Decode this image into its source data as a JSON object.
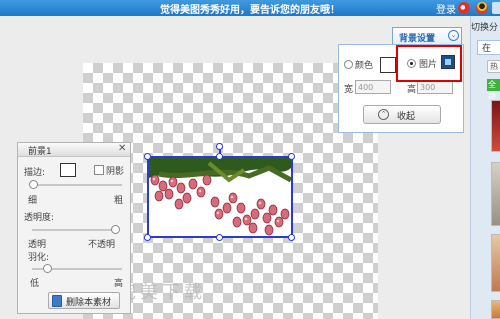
{
  "topbar": {
    "title": "觉得美图秀秀好用，要告诉您的朋友哦！",
    "login": "登录",
    "icons": [
      "weibo-icon",
      "qq-icon"
    ]
  },
  "foreground_panel": {
    "title": "前景1",
    "close": "✕",
    "border_label": "描边:",
    "shadow_label": "阴影",
    "thin_label": "细",
    "thick_label": "粗",
    "opacity_label": "透明度:",
    "transparent_label": "透明",
    "opaque_label": "不透明",
    "feather_label": "羽化:",
    "low_label": "低",
    "high_label": "高",
    "delete_label": "删除本素材"
  },
  "background_settings": {
    "tab_label": "背景设置",
    "color_label": "颜色",
    "picture_label": "图片",
    "selected_option": "图片",
    "width_label": "宽",
    "height_label": "高",
    "width_value": "400",
    "height_value": "300",
    "collapse_label": "收起"
  },
  "right_panel": {
    "switch_tab": "切换分",
    "subtab": "在",
    "hot": "热",
    "all": "全部"
  },
  "watermark": "完美下载",
  "colors": {
    "topbar": "#2b86d6",
    "selection": "#2a3bd0",
    "highlight": "#e00000"
  }
}
